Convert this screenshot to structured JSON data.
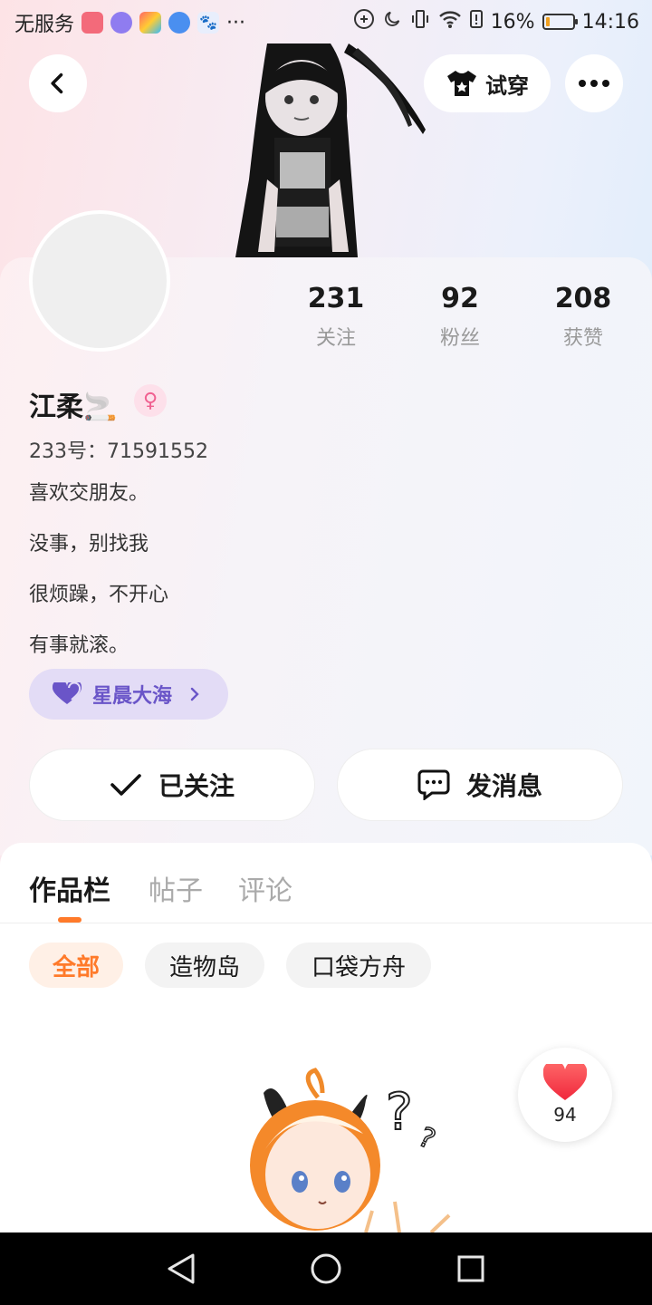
{
  "status_bar": {
    "carrier": "无服务",
    "dots": "···",
    "battery": "16%",
    "time": "14:16",
    "battery_level": 0.16
  },
  "top": {
    "back_icon": "chevron-left-icon",
    "try_on_label": "试穿",
    "more_icon": "more-horizontal-icon"
  },
  "profile": {
    "name": "江柔🚬",
    "gender": "female",
    "uid": "233号：71591552",
    "bio": [
      "喜欢交朋友。",
      "没事，别找我",
      "很烦躁，不开心",
      "有事就滚。"
    ],
    "group": "星晨大海",
    "stats": [
      {
        "value": "231",
        "label": "关注"
      },
      {
        "value": "92",
        "label": "粉丝"
      },
      {
        "value": "208",
        "label": "获赞"
      }
    ]
  },
  "actions": {
    "follow_label": "已关注",
    "message_label": "发消息"
  },
  "tabs": [
    {
      "label": "作品栏",
      "active": true
    },
    {
      "label": "帖子",
      "active": false
    },
    {
      "label": "评论",
      "active": false
    }
  ],
  "filters": [
    {
      "label": "全部",
      "active": true
    },
    {
      "label": "造物岛",
      "active": false
    },
    {
      "label": "口袋方舟",
      "active": false
    }
  ],
  "like_bubble": {
    "count": "94"
  },
  "colors": {
    "accent": "#ff7a2a",
    "group_pill": "#e3dcf6",
    "group_text": "#6a55c8",
    "female": "#f06090"
  }
}
